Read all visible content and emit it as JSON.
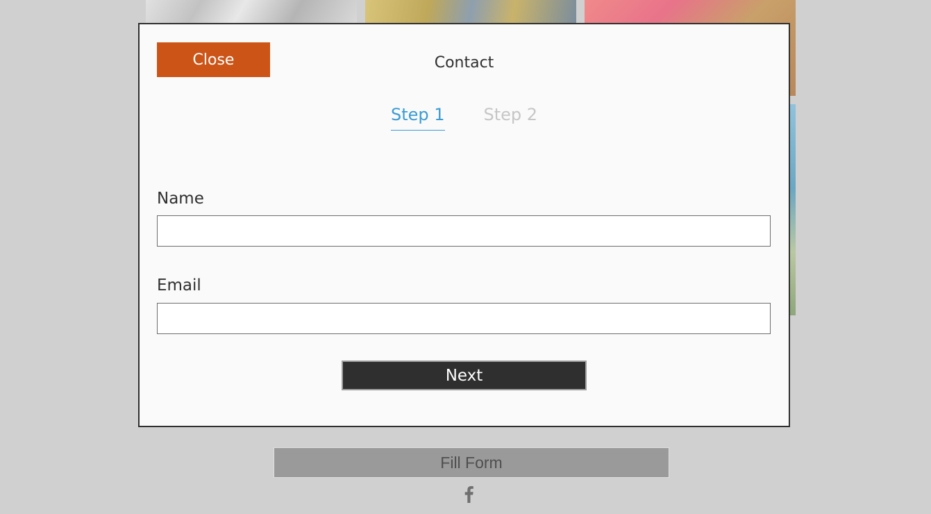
{
  "modal": {
    "title": "Contact",
    "close_label": "Close",
    "steps": [
      {
        "label": "Step 1",
        "state": "active"
      },
      {
        "label": "Step 2",
        "state": "inactive"
      }
    ],
    "fields": {
      "name": {
        "label": "Name",
        "value": "",
        "placeholder": ""
      },
      "email": {
        "label": "Email",
        "value": "",
        "placeholder": ""
      }
    },
    "next_label": "Next"
  },
  "page": {
    "fill_form_label": "Fill Form",
    "social_icon": "facebook-icon"
  },
  "colors": {
    "accent": "#cc5417",
    "step_active": "#3a9bd5",
    "step_inactive": "#c6c6c6",
    "dark_button": "#2f2f2f",
    "backdrop": "#d0d0d0"
  }
}
